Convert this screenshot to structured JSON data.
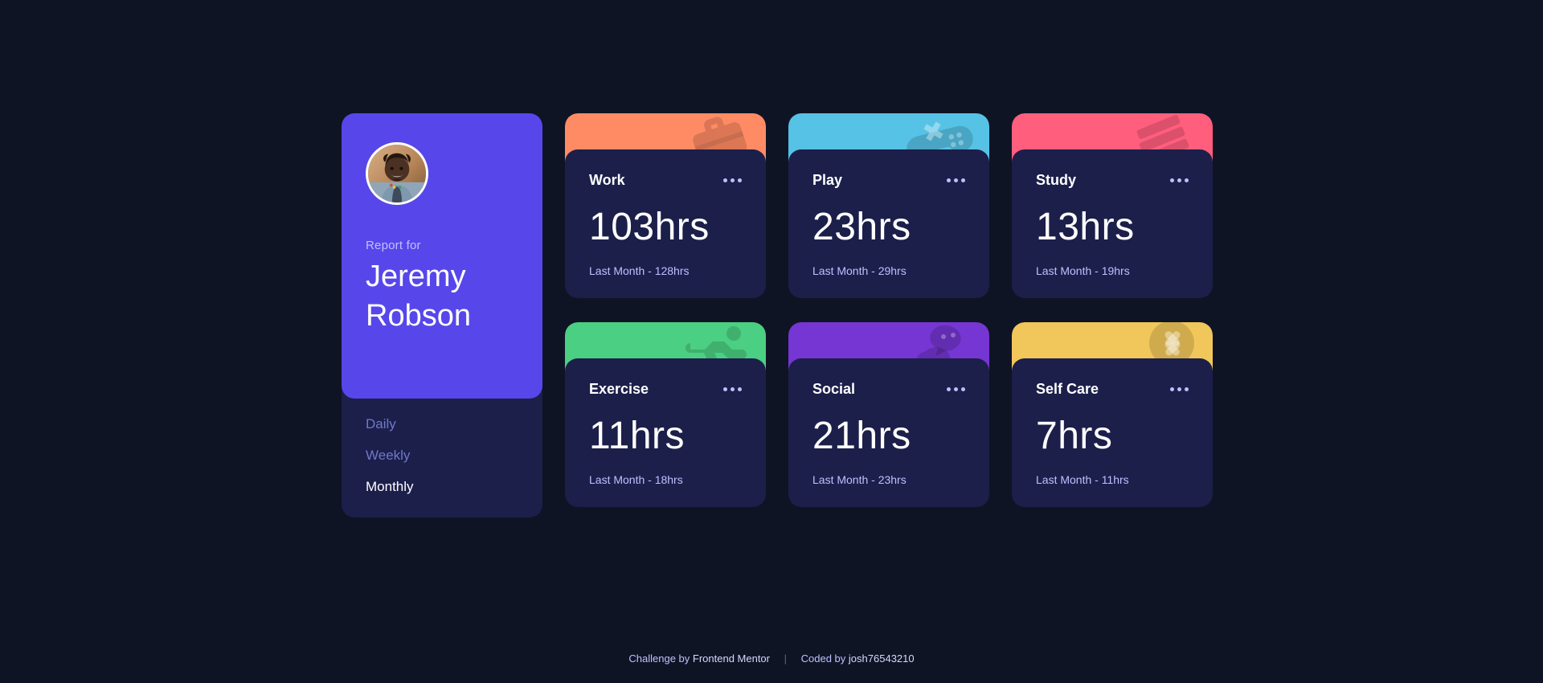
{
  "theme": {
    "page_background": "#0F1424",
    "card_background": "#1C1F4A",
    "profile_accent": "#5747EA",
    "muted_text": "#BDC1FF"
  },
  "profile": {
    "avatar_alt": "avatar",
    "report_label": "Report for",
    "name_line1": "Jeremy",
    "name_line2": "Robson",
    "ranges": [
      {
        "label": "Daily",
        "active": false
      },
      {
        "label": "Weekly",
        "active": false
      },
      {
        "label": "Monthly",
        "active": true
      }
    ]
  },
  "cards": [
    {
      "title": "Work",
      "current": "103hrs",
      "previous": "Last Month - 128hrs",
      "accent": "#FF8B64",
      "icon": "briefcase-icon",
      "menu": "ellipsis-icon"
    },
    {
      "title": "Play",
      "current": "23hrs",
      "previous": "Last Month - 29hrs",
      "accent": "#56C2E6",
      "icon": "game-controller-icon",
      "menu": "ellipsis-icon"
    },
    {
      "title": "Study",
      "current": "13hrs",
      "previous": "Last Month - 19hrs",
      "accent": "#FF5E7D",
      "icon": "books-icon",
      "menu": "ellipsis-icon"
    },
    {
      "title": "Exercise",
      "current": "11hrs",
      "previous": "Last Month - 18hrs",
      "accent": "#4BCF82",
      "icon": "running-person-icon",
      "menu": "ellipsis-icon"
    },
    {
      "title": "Social",
      "current": "21hrs",
      "previous": "Last Month - 23hrs",
      "accent": "#7536D3",
      "icon": "chat-bubbles-icon",
      "menu": "ellipsis-icon"
    },
    {
      "title": "Self Care",
      "current": "7hrs",
      "previous": "Last Month - 11hrs",
      "accent": "#F1C65B",
      "icon": "flower-icon",
      "menu": "ellipsis-icon"
    }
  ],
  "footer": {
    "challenge_prefix": "Challenge by",
    "challenge_link": "Frontend Mentor",
    "separator": "|",
    "coded_prefix": "Coded by",
    "coded_link": "josh76543210"
  }
}
